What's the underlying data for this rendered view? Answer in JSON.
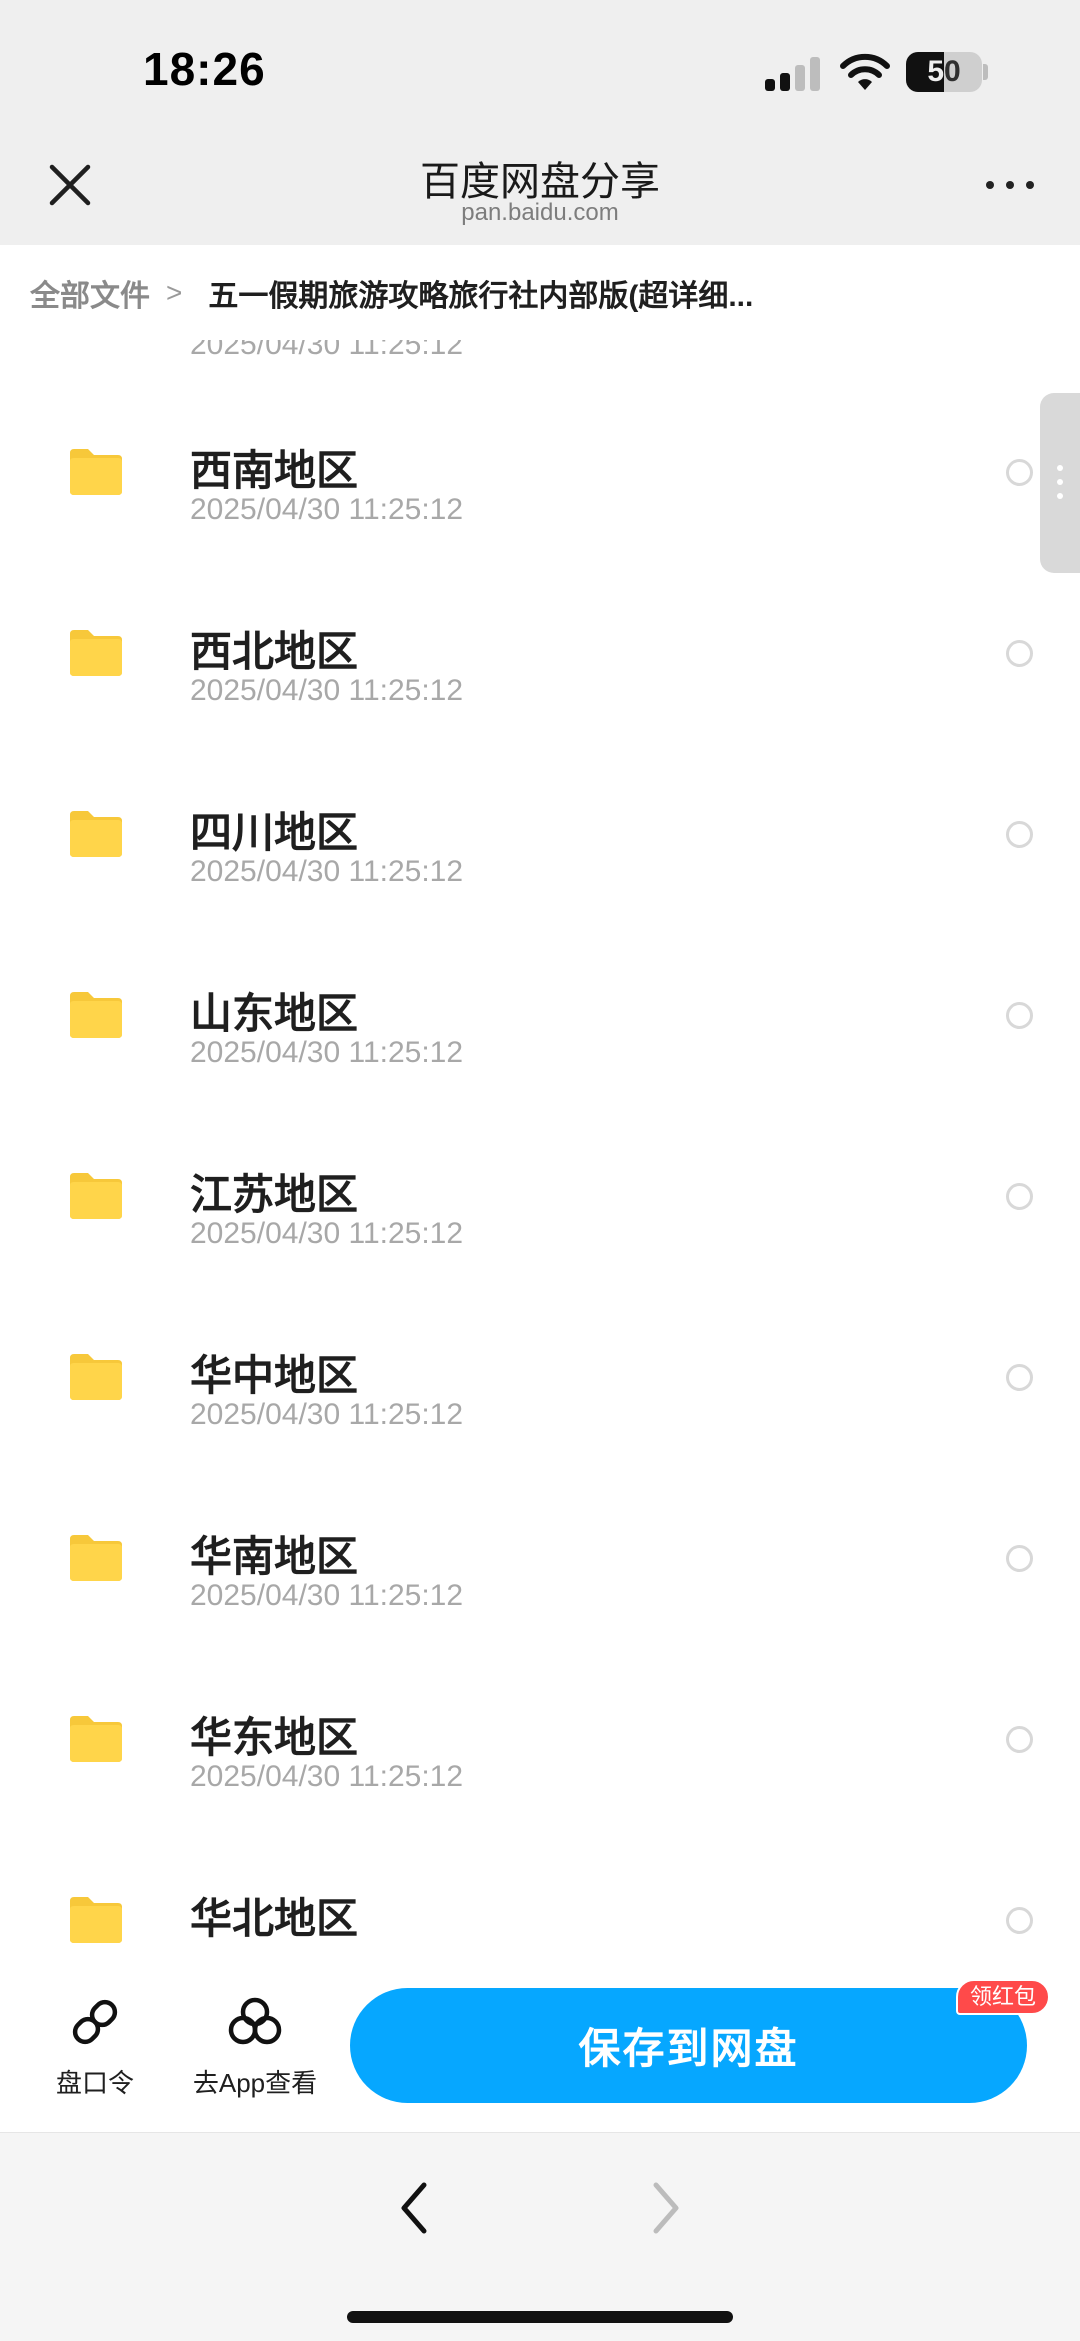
{
  "status_bar": {
    "time": "18:26",
    "battery": "50"
  },
  "header": {
    "title": "百度网盘分享",
    "subtitle": "pan.baidu.com"
  },
  "breadcrumb": {
    "root": "全部文件",
    "separator": ">",
    "current": "五一假期旅游攻略旅行社内部版(超详细..."
  },
  "partial_top_item": {
    "date": "2025/04/30 11:25:12"
  },
  "files": [
    {
      "name": "西南地区",
      "date": "2025/04/30 11:25:12"
    },
    {
      "name": "西北地区",
      "date": "2025/04/30 11:25:12"
    },
    {
      "name": "四川地区",
      "date": "2025/04/30 11:25:12"
    },
    {
      "name": "山东地区",
      "date": "2025/04/30 11:25:12"
    },
    {
      "name": "江苏地区",
      "date": "2025/04/30 11:25:12"
    },
    {
      "name": "华中地区",
      "date": "2025/04/30 11:25:12"
    },
    {
      "name": "华南地区",
      "date": "2025/04/30 11:25:12"
    },
    {
      "name": "华东地区",
      "date": "2025/04/30 11:25:12"
    },
    {
      "name": "华北地区",
      "date": ""
    }
  ],
  "bottom_bar": {
    "link_label": "盘口令",
    "app_label": "去App查看",
    "save_label": "保存到网盘",
    "badge": "领红包"
  },
  "colors": {
    "accent": "#06a7ff",
    "folder": "#ffd54a",
    "badge": "#ff4a4a"
  },
  "icons": [
    "close-icon",
    "more-icon",
    "folder-icon",
    "link-icon",
    "app-icon",
    "back-arrow-icon",
    "forward-arrow-icon"
  ]
}
